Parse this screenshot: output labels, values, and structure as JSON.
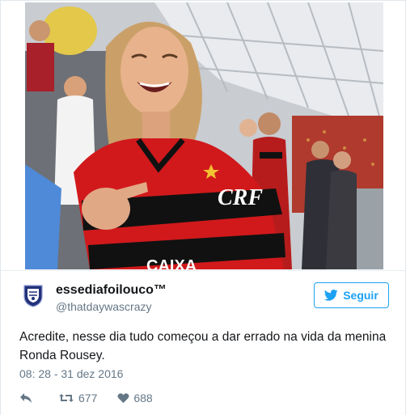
{
  "account": {
    "display_name": "essediafoilouco™",
    "handle": "@thatdaywascrazy",
    "avatar_icon": "shield-crest-icon"
  },
  "follow_button": {
    "label": "Seguir",
    "icon": "bird-icon",
    "color": "#1da1f2"
  },
  "tweet": {
    "text": "Acredite, nesse dia tudo começou a dar errado na vida da menina Ronda Rousey.",
    "timestamp": "08: 28 - 31 dez 2016"
  },
  "actions": {
    "reply_icon": "reply-arrow-icon",
    "retweet_icon": "retweet-icon",
    "retweet_count": "677",
    "like_icon": "heart-icon",
    "like_count": "688"
  },
  "photo": {
    "jersey_text": "CRF",
    "sponsor_text": "CAIXA",
    "colors": {
      "jersey_red": "#d1191c",
      "jersey_black": "#111111"
    }
  }
}
